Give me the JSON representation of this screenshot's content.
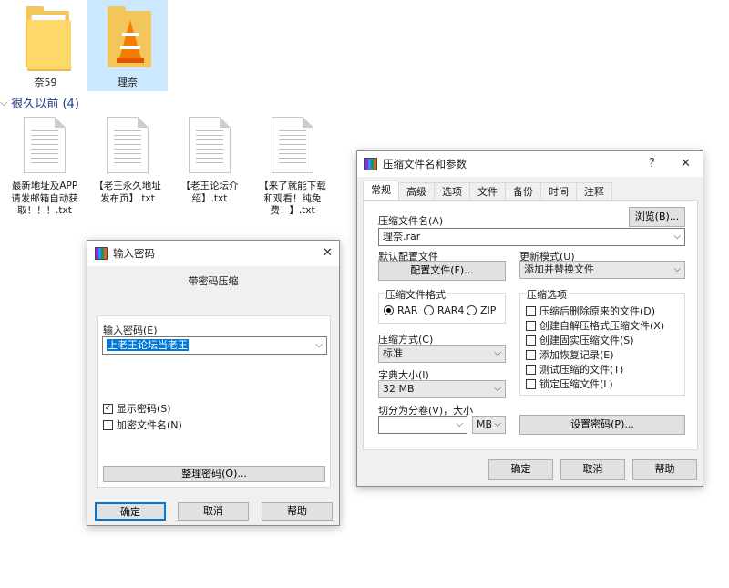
{
  "explorer": {
    "folders": [
      {
        "label": "奈59"
      },
      {
        "label": "理奈"
      }
    ],
    "group": {
      "title": "很久以前 (4)"
    },
    "files": [
      {
        "label": "最新地址及APP请发邮箱自动获取！！！.txt"
      },
      {
        "label": "【老王永久地址发布页】.txt"
      },
      {
        "label": "【老王论坛介绍】.txt"
      },
      {
        "label": "【来了就能下载和观看！纯免费！】.txt"
      }
    ]
  },
  "password_dialog": {
    "title": "输入密码",
    "heading": "带密码压缩",
    "password_label": "输入密码(E)",
    "password_value": "上老王论坛当老王",
    "show_password": "显示密码(S)",
    "encrypt_names": "加密文件名(N)",
    "organize_button": "整理密码(O)...",
    "ok": "确定",
    "cancel": "取消",
    "help": "帮助"
  },
  "archive_dialog": {
    "title": "压缩文件名和参数",
    "help_glyph": "?",
    "close_glyph": "✕",
    "tabs": [
      "常规",
      "高级",
      "选项",
      "文件",
      "备份",
      "时间",
      "注释"
    ],
    "archive_name_label": "压缩文件名(A)",
    "browse_button": "浏览(B)...",
    "archive_name_value": "理奈.rar",
    "default_profile_label": "默认配置文件",
    "profile_button": "配置文件(F)...",
    "update_mode_label": "更新模式(U)",
    "update_mode_value": "添加并替换文件",
    "format_group": "压缩文件格式",
    "formats": [
      "RAR",
      "RAR4",
      "ZIP"
    ],
    "method_label": "压缩方式(C)",
    "method_value": "标准",
    "dict_label": "字典大小(I)",
    "dict_value": "32 MB",
    "split_label": "切分为分卷(V)，大小",
    "split_unit": "MB",
    "options_group": "压缩选项",
    "options": [
      "压缩后删除原来的文件(D)",
      "创建自解压格式压缩文件(X)",
      "创建固实压缩文件(S)",
      "添加恢复记录(E)",
      "测试压缩的文件(T)",
      "锁定压缩文件(L)"
    ],
    "set_password_button": "设置密码(P)...",
    "ok": "确定",
    "cancel": "取消",
    "help": "帮助"
  }
}
